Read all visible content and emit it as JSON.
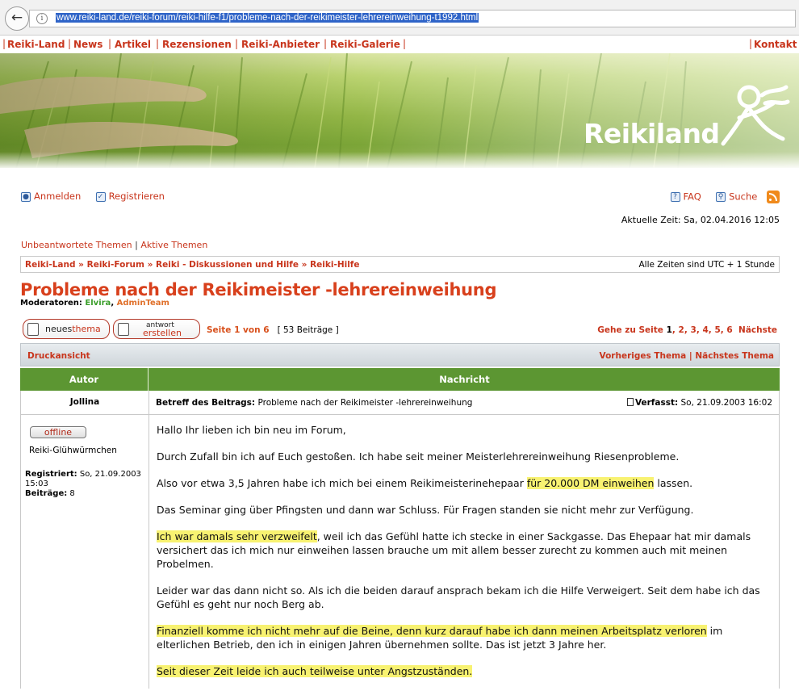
{
  "browser": {
    "url": "www.reiki-land.de/reiki-forum/reiki-hilfe-f1/probleme-nach-der-reikimeister-lehrereinweihung-t1992.html"
  },
  "topnav": {
    "items": [
      "Reiki-Land",
      "News",
      "Artikel",
      "Rezensionen",
      "Reiki-Anbieter",
      "Reiki-Galerie"
    ],
    "contact": "Kontakt"
  },
  "banner": {
    "logo": "Reikiland"
  },
  "userlinks": {
    "login": "Anmelden",
    "register": "Registrieren",
    "faq": "FAQ",
    "search": "Suche"
  },
  "current_time": "Aktuelle Zeit: Sa, 02.04.2016 12:05",
  "quicklinks": {
    "unanswered": "Unbeantwortete Themen",
    "sep": "|",
    "active": "Aktive Themen"
  },
  "breadcrumb": {
    "items": [
      "Reiki-Land",
      "Reiki-Forum",
      "Reiki - Diskussionen und Hilfe",
      "Reiki-Hilfe"
    ],
    "sep": "»",
    "timezone": "Alle Zeiten sind UTC + 1 Stunde"
  },
  "topic": {
    "title": "Probleme nach der Reikimeister -lehrereinweihung",
    "moderators_label": "Moderatoren:",
    "moderator_1": "Elvira",
    "moderator_2": "AdminTeam"
  },
  "buttons": {
    "new_topic_a": "neues",
    "new_topic_b": "thema",
    "reply_a": "antwort",
    "reply_b": "erstellen"
  },
  "pagination": {
    "page_info": "Seite 1 von 6",
    "post_count": "[ 53 Beiträge ]",
    "goto_label": "Gehe zu Seite",
    "pages": [
      "1",
      "2",
      "3",
      "4",
      "5",
      "6"
    ],
    "next": "Nächste"
  },
  "printbar": {
    "print": "Druckansicht",
    "prev": "Vorheriges Thema",
    "sep": "|",
    "next": "Nächstes Thema"
  },
  "table": {
    "col_author": "Autor",
    "col_message": "Nachricht"
  },
  "post": {
    "author": "Jollina",
    "subject_label": "Betreff des Beitrags:",
    "subject": "Probleme nach der Reikimeister -lehrereinweihung",
    "posted_label": "Verfasst:",
    "posted": "So, 21.09.2003 16:02",
    "status": "offline",
    "rank": "Reiki-Glühwürmchen",
    "registered_label": "Registriert:",
    "registered": "So, 21.09.2003 15:03",
    "posts_label": "Beiträge:",
    "posts": "8",
    "paragraphs": [
      "Hallo Ihr lieben ich bin neu im Forum,",
      "Durch Zufall bin ich auf Euch gestoßen. Ich habe seit meiner Meisterlehrereinweihung Riesenprobleme.",
      "Also vor etwa 3,5 Jahren habe ich mich bei einem Reikimeisterinehepaar",
      "für 20.000 DM einweihen",
      "lassen.",
      "Das Seminar ging über Pfingsten und dann war Schluss. Für Fragen standen sie nicht mehr zur Verfügung.",
      "Ich war damals sehr verzweifelt",
      ", weil ich das Gefühl hatte ich stecke in einer Sackgasse. Das Ehepaar hat mir damals versichert das ich mich nur einweihen lassen brauche um mit allem besser zurecht zu kommen auch mit meinen Probelmen.",
      "Leider war das dann nicht so. Als ich die beiden darauf ansprach bekam ich die Hilfe Verweigert. Seit dem habe ich das Gefühl es geht nur noch Berg ab.",
      "Finanziell komme ich nicht mehr auf die Beine, denn kurz darauf habe ich dann meinen Arbeitsplatz verloren",
      " im elterlichen Betrieb, den ich in einigen Jahren übernehmen sollte. Das ist jetzt 3 Jahre her.",
      "Seit dieser Zeit leide ich auch teilweise unter Angstzuständen."
    ]
  },
  "colors": {
    "accent": "#c8351c",
    "table_header": "#5c9632",
    "highlight": "#f8f271"
  }
}
